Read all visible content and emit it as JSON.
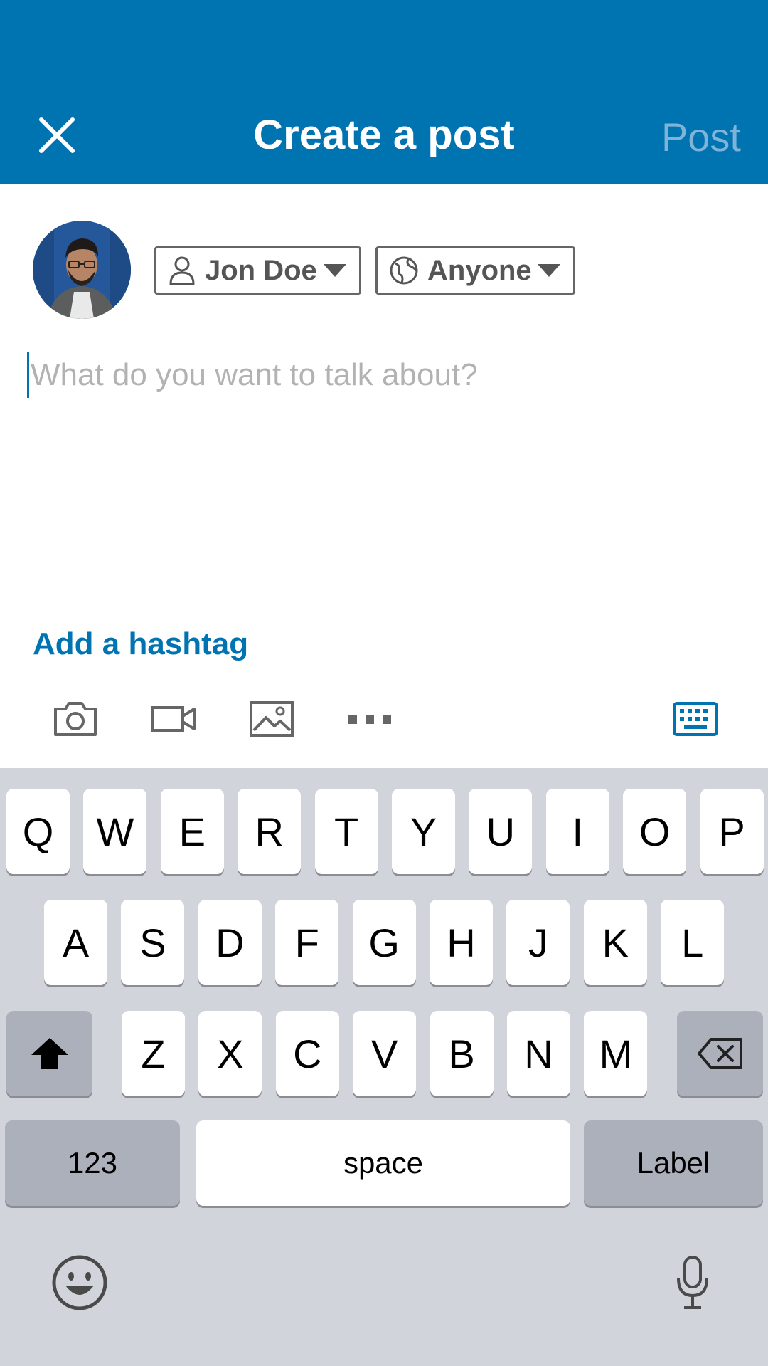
{
  "header": {
    "title": "Create a post",
    "post_label": "Post",
    "background": "#0073b1"
  },
  "author": {
    "name": "Jon Doe",
    "visibility": "Anyone"
  },
  "composer": {
    "placeholder": "What do you want to talk about?",
    "value": ""
  },
  "hashtag_label": "Add a hashtag",
  "toolbar": {
    "icons": [
      "camera-icon",
      "video-icon",
      "image-icon",
      "more-icon",
      "keyboard-icon"
    ]
  },
  "keyboard": {
    "row1": [
      "Q",
      "W",
      "E",
      "R",
      "T",
      "Y",
      "U",
      "I",
      "O",
      "P"
    ],
    "row2": [
      "A",
      "S",
      "D",
      "F",
      "G",
      "H",
      "J",
      "K",
      "L"
    ],
    "row3": [
      "Z",
      "X",
      "C",
      "V",
      "B",
      "N",
      "M"
    ],
    "numbers_label": "123",
    "space_label": "space",
    "return_label": "Label"
  },
  "colors": {
    "accent": "#0073b1",
    "post_disabled": "#7fb4d8",
    "keyboard_bg": "#d1d4db"
  }
}
